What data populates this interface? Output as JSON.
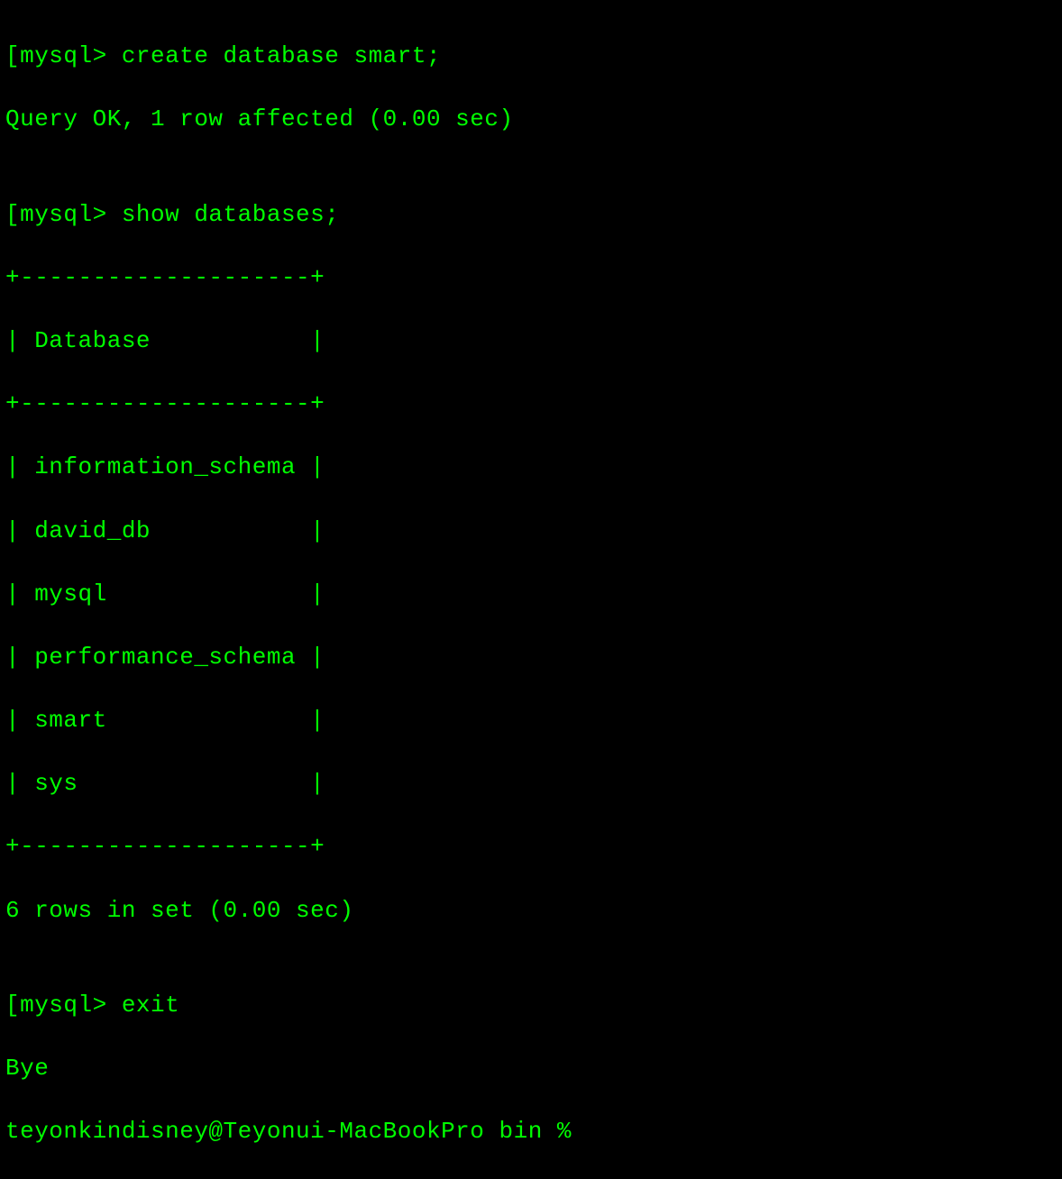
{
  "terminal": {
    "l0": "[mysql> create database smart;",
    "l1": "Query OK, 1 row affected (0.00 sec)",
    "l2": "",
    "l3": "[mysql> show databases;",
    "l4": "+--------------------+",
    "l5": "| Database           |",
    "l6": "+--------------------+",
    "l7": "| information_schema |",
    "l8": "| david_db           |",
    "l9": "| mysql              |",
    "l10": "| performance_schema |",
    "l11": "| smart              |",
    "l12": "| sys                |",
    "l13": "+--------------------+",
    "l14": "6 rows in set (0.00 sec)",
    "l15": "",
    "l16": "[mysql> exit",
    "l17": "Bye",
    "l18": "teyonkindisney@Teyonui-MacBookPro bin % "
  }
}
